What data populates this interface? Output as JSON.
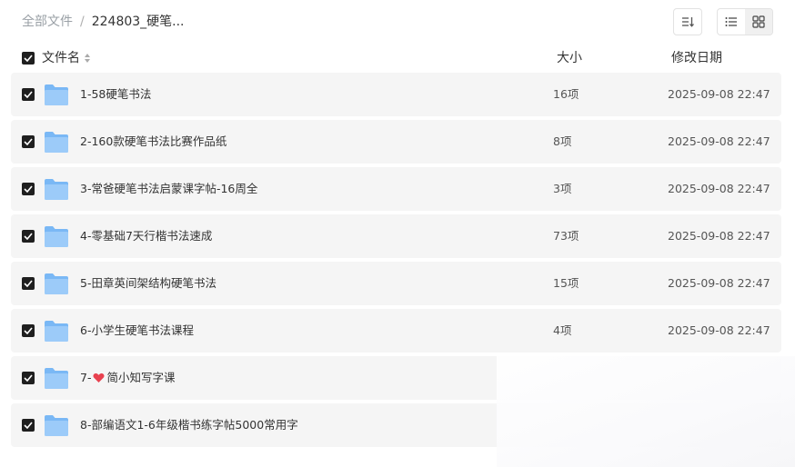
{
  "breadcrumb": {
    "root": "全部文件",
    "separator": "/",
    "current": "224803_硬笔..."
  },
  "toolbar": {
    "sort_icon": "sort-icon",
    "list_view_icon": "list-view-icon",
    "grid_view_icon": "grid-view-icon",
    "active_view": "grid"
  },
  "columns": {
    "name": "文件名",
    "size": "大小",
    "date": "修改日期"
  },
  "rows": [
    {
      "name": "1-58硬笔书法",
      "size": "16项",
      "date": "2025-09-08 22:47",
      "checked": true
    },
    {
      "name": "2-160款硬笔书法比赛作品纸",
      "size": "8项",
      "date": "2025-09-08 22:47",
      "checked": true
    },
    {
      "name": "3-常爸硬笔书法启蒙课字帖-16周全",
      "size": "3项",
      "date": "2025-09-08 22:47",
      "checked": true
    },
    {
      "name": "4-零基础7天行楷书法速成",
      "size": "73项",
      "date": "2025-09-08 22:47",
      "checked": true
    },
    {
      "name": "5-田章英间架结构硬笔书法",
      "size": "15项",
      "date": "2025-09-08 22:47",
      "checked": true
    },
    {
      "name": "6-小学生硬笔书法课程",
      "size": "4项",
      "date": "2025-09-08 22:47",
      "checked": true
    },
    {
      "name_prefix": "7-",
      "name_suffix": "简小知写字课",
      "heart_icon": "heart-icon",
      "checked": true
    },
    {
      "name": "8-部编语文1-6年级楷书练字帖5000常用字",
      "checked": true
    }
  ],
  "colors": {
    "folder": "#7ab8f5",
    "heart": "#e8414f",
    "row_bg": "#f5f5f5",
    "checkbox": "#1f1f1f"
  }
}
